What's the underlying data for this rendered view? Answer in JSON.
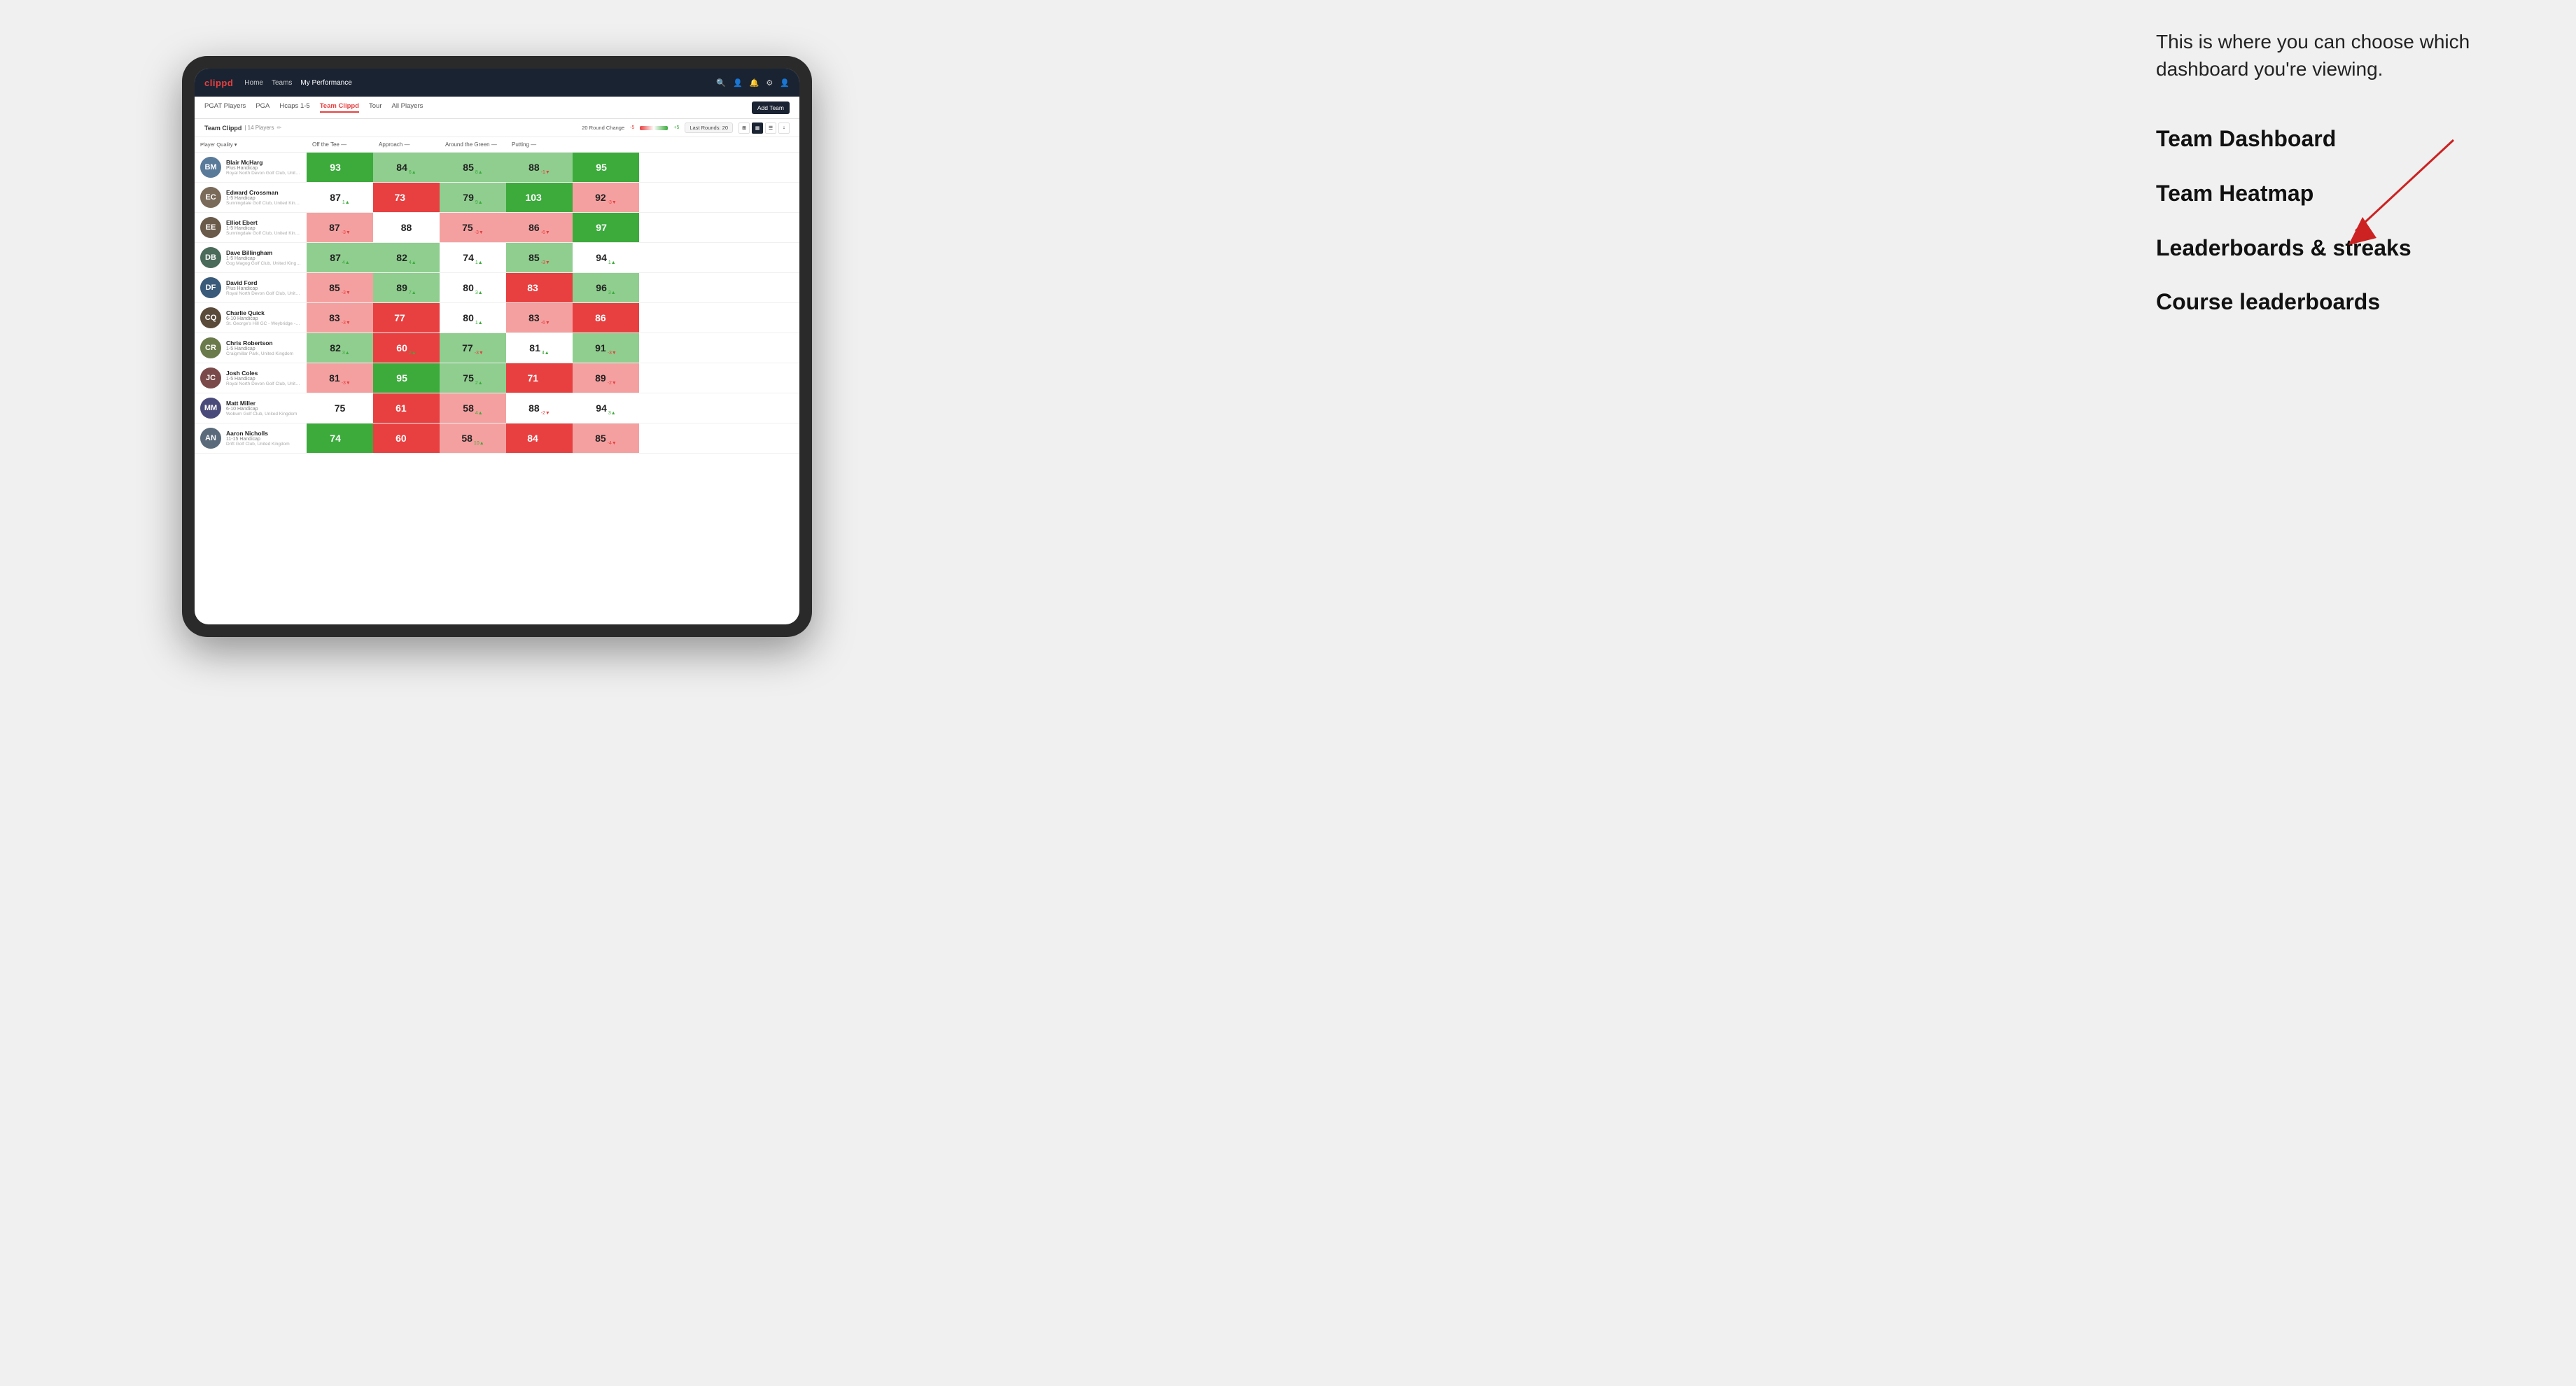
{
  "annotation": {
    "intro": "This is where you can choose which dashboard you're viewing.",
    "items": [
      "Team Dashboard",
      "Team Heatmap",
      "Leaderboards & streaks",
      "Course leaderboards"
    ]
  },
  "navbar": {
    "logo": "clippd",
    "links": [
      "Home",
      "Teams",
      "My Performance"
    ],
    "active_link": "My Performance"
  },
  "subnav": {
    "links": [
      "PGAT Players",
      "PGA",
      "Hcaps 1-5",
      "Team Clippd",
      "Tour",
      "All Players"
    ],
    "active": "Team Clippd",
    "add_team": "Add Team"
  },
  "teambar": {
    "name": "Team Clippd",
    "separator": "|",
    "count": "14 Players",
    "round_change_label": "20 Round Change",
    "change_neg": "-5",
    "change_pos": "+5",
    "last_rounds_label": "Last Rounds:",
    "last_rounds_value": "20"
  },
  "table": {
    "columns": [
      "Player Quality ▾",
      "Off the Tee —",
      "Approach —",
      "Around the Green —",
      "Putting —"
    ],
    "players": [
      {
        "name": "Blair McHarg",
        "handicap": "Plus Handicap",
        "club": "Royal North Devon Golf Club, United Kingdom",
        "initials": "BM",
        "color": "#5a7a9a",
        "scores": [
          {
            "value": "93",
            "change": "9▲",
            "bg": "bg-green-dark",
            "change_dir": "up"
          },
          {
            "value": "84",
            "change": "6▲",
            "bg": "bg-green-light",
            "change_dir": "up"
          },
          {
            "value": "85",
            "change": "8▲",
            "bg": "bg-green-light",
            "change_dir": "up"
          },
          {
            "value": "88",
            "change": "-1▼",
            "bg": "bg-green-light",
            "change_dir": "down"
          },
          {
            "value": "95",
            "change": "9▲",
            "bg": "bg-green-dark",
            "change_dir": "up"
          }
        ]
      },
      {
        "name": "Edward Crossman",
        "handicap": "1-5 Handicap",
        "club": "Sunningdale Golf Club, United Kingdom",
        "initials": "EC",
        "color": "#7a6a5a",
        "scores": [
          {
            "value": "87",
            "change": "1▲",
            "bg": "bg-white",
            "change_dir": "up"
          },
          {
            "value": "73",
            "change": "-11▼",
            "bg": "bg-red-dark",
            "change_dir": "down"
          },
          {
            "value": "79",
            "change": "9▲",
            "bg": "bg-green-light",
            "change_dir": "up"
          },
          {
            "value": "103",
            "change": "15▲",
            "bg": "bg-green-dark",
            "change_dir": "up"
          },
          {
            "value": "92",
            "change": "-3▼",
            "bg": "bg-red-light",
            "change_dir": "down"
          }
        ]
      },
      {
        "name": "Elliot Ebert",
        "handicap": "1-5 Handicap",
        "club": "Sunningdale Golf Club, United Kingdom",
        "initials": "EE",
        "color": "#6a5a4a",
        "scores": [
          {
            "value": "87",
            "change": "-3▼",
            "bg": "bg-red-light",
            "change_dir": "down"
          },
          {
            "value": "88",
            "change": "",
            "bg": "bg-white",
            "change_dir": ""
          },
          {
            "value": "75",
            "change": "-3▼",
            "bg": "bg-red-light",
            "change_dir": "down"
          },
          {
            "value": "86",
            "change": "-6▼",
            "bg": "bg-red-light",
            "change_dir": "down"
          },
          {
            "value": "97",
            "change": "5▲",
            "bg": "bg-green-dark",
            "change_dir": "up"
          }
        ]
      },
      {
        "name": "Dave Billingham",
        "handicap": "1-5 Handicap",
        "club": "Gog Magog Golf Club, United Kingdom",
        "initials": "DB",
        "color": "#4a6a5a",
        "scores": [
          {
            "value": "87",
            "change": "4▲",
            "bg": "bg-green-light",
            "change_dir": "up"
          },
          {
            "value": "82",
            "change": "4▲",
            "bg": "bg-green-light",
            "change_dir": "up"
          },
          {
            "value": "74",
            "change": "1▲",
            "bg": "bg-white",
            "change_dir": "up"
          },
          {
            "value": "85",
            "change": "-3▼",
            "bg": "bg-green-light",
            "change_dir": "down"
          },
          {
            "value": "94",
            "change": "1▲",
            "bg": "bg-white",
            "change_dir": "up"
          }
        ]
      },
      {
        "name": "David Ford",
        "handicap": "Plus Handicap",
        "club": "Royal North Devon Golf Club, United Kingdom",
        "initials": "DF",
        "color": "#3a5a7a",
        "scores": [
          {
            "value": "85",
            "change": "-3▼",
            "bg": "bg-red-light",
            "change_dir": "down"
          },
          {
            "value": "89",
            "change": "7▲",
            "bg": "bg-green-light",
            "change_dir": "up"
          },
          {
            "value": "80",
            "change": "3▲",
            "bg": "bg-white",
            "change_dir": "up"
          },
          {
            "value": "83",
            "change": "-10▼",
            "bg": "bg-red-dark",
            "change_dir": "down"
          },
          {
            "value": "96",
            "change": "3▲",
            "bg": "bg-green-light",
            "change_dir": "up"
          }
        ]
      },
      {
        "name": "Charlie Quick",
        "handicap": "6-10 Handicap",
        "club": "St. George's Hill GC - Weybridge - Surrey, Uni...",
        "initials": "CQ",
        "color": "#5a4a3a",
        "scores": [
          {
            "value": "83",
            "change": "-3▼",
            "bg": "bg-red-light",
            "change_dir": "down"
          },
          {
            "value": "77",
            "change": "-14▼",
            "bg": "bg-red-dark",
            "change_dir": "down"
          },
          {
            "value": "80",
            "change": "1▲",
            "bg": "bg-white",
            "change_dir": "up"
          },
          {
            "value": "83",
            "change": "-6▼",
            "bg": "bg-red-light",
            "change_dir": "down"
          },
          {
            "value": "86",
            "change": "-8▼",
            "bg": "bg-red-dark",
            "change_dir": "down"
          }
        ]
      },
      {
        "name": "Chris Robertson",
        "handicap": "1-5 Handicap",
        "club": "Craigmillar Park, United Kingdom",
        "initials": "CR",
        "color": "#6a7a4a",
        "scores": [
          {
            "value": "82",
            "change": "3▲",
            "bg": "bg-green-light",
            "change_dir": "up"
          },
          {
            "value": "60",
            "change": "2▲",
            "bg": "bg-red-dark",
            "change_dir": "up"
          },
          {
            "value": "77",
            "change": "-3▼",
            "bg": "bg-green-light",
            "change_dir": "down"
          },
          {
            "value": "81",
            "change": "4▲",
            "bg": "bg-white",
            "change_dir": "up"
          },
          {
            "value": "91",
            "change": "-3▼",
            "bg": "bg-green-light",
            "change_dir": "down"
          }
        ]
      },
      {
        "name": "Josh Coles",
        "handicap": "1-5 Handicap",
        "club": "Royal North Devon Golf Club, United Kingdom",
        "initials": "JC",
        "color": "#7a4a4a",
        "scores": [
          {
            "value": "81",
            "change": "-3▼",
            "bg": "bg-red-light",
            "change_dir": "down"
          },
          {
            "value": "95",
            "change": "8▲",
            "bg": "bg-green-dark",
            "change_dir": "up"
          },
          {
            "value": "75",
            "change": "2▲",
            "bg": "bg-green-light",
            "change_dir": "up"
          },
          {
            "value": "71",
            "change": "-11▼",
            "bg": "bg-red-dark",
            "change_dir": "down"
          },
          {
            "value": "89",
            "change": "-2▼",
            "bg": "bg-red-light",
            "change_dir": "down"
          }
        ]
      },
      {
        "name": "Matt Miller",
        "handicap": "6-10 Handicap",
        "club": "Woburn Golf Club, United Kingdom",
        "initials": "MM",
        "color": "#4a4a7a",
        "scores": [
          {
            "value": "75",
            "change": "",
            "bg": "bg-white",
            "change_dir": ""
          },
          {
            "value": "61",
            "change": "-3▼",
            "bg": "bg-red-dark",
            "change_dir": "down"
          },
          {
            "value": "58",
            "change": "4▲",
            "bg": "bg-red-light",
            "change_dir": "up"
          },
          {
            "value": "88",
            "change": "-2▼",
            "bg": "bg-white",
            "change_dir": "down"
          },
          {
            "value": "94",
            "change": "3▲",
            "bg": "bg-white",
            "change_dir": "up"
          }
        ]
      },
      {
        "name": "Aaron Nicholls",
        "handicap": "11-15 Handicap",
        "club": "Drift Golf Club, United Kingdom",
        "initials": "AN",
        "color": "#5a6a7a",
        "scores": [
          {
            "value": "74",
            "change": "8▲",
            "bg": "bg-green-dark",
            "change_dir": "up"
          },
          {
            "value": "60",
            "change": "-1▼",
            "bg": "bg-red-dark",
            "change_dir": "down"
          },
          {
            "value": "58",
            "change": "10▲",
            "bg": "bg-red-light",
            "change_dir": "up"
          },
          {
            "value": "84",
            "change": "-21▼",
            "bg": "bg-red-dark",
            "change_dir": "down"
          },
          {
            "value": "85",
            "change": "-4▼",
            "bg": "bg-red-light",
            "change_dir": "down"
          }
        ]
      }
    ]
  }
}
